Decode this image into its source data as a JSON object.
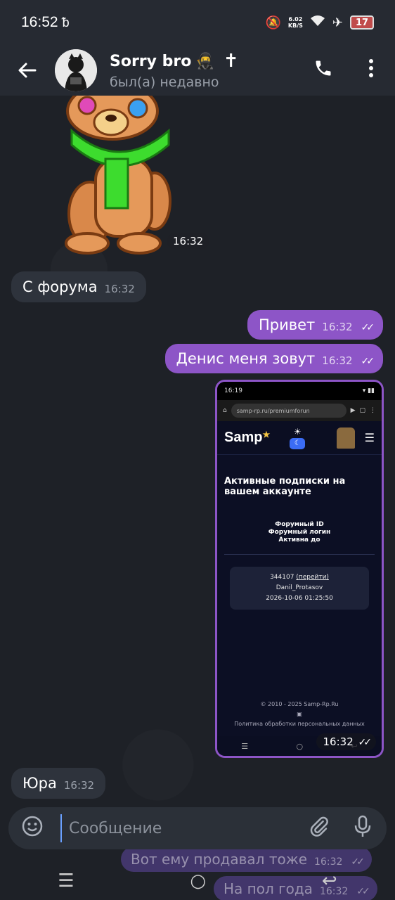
{
  "status": {
    "time": "16:52",
    "net_speed_top": "6.02",
    "net_speed_bottom": "KB/S",
    "battery": "17"
  },
  "header": {
    "title": "Sorry bro",
    "subtitle": "был(а) недавно"
  },
  "messages": [
    {
      "type": "sticker",
      "time": "16:32"
    },
    {
      "type": "in",
      "text": "С форума",
      "time": "16:32"
    },
    {
      "type": "out",
      "text": "Привет",
      "time": "16:32"
    },
    {
      "type": "out",
      "text": "Денис меня зовут",
      "time": "16:32"
    },
    {
      "type": "out-image",
      "time": "16:32"
    },
    {
      "type": "in",
      "text": "Юра",
      "time": "16:32"
    },
    {
      "type": "out",
      "text": "Вот ему продавал тоже",
      "time": "16:32"
    },
    {
      "type": "out",
      "text": "На пол года",
      "time": "16:32"
    }
  ],
  "screenshot": {
    "status_time": "16:19",
    "url": "samp-rp.ru/premiumforun",
    "logo": "Samp",
    "heading": "Активные подписки на вашем аккаунте",
    "field_1": "Форумный ID",
    "field_2": "Форумный логин",
    "field_3": "Активна до",
    "id_value": "344107",
    "id_link": "(перейти)",
    "login_value": "Danil_Protasov",
    "active_until": "2026-10-06 01:25:50",
    "footer_1": "© 2010 - 2025 Samp-Rp.Ru",
    "footer_2": "Политика обработки персональных данных"
  },
  "composer": {
    "placeholder": "Сообщение"
  },
  "colors": {
    "outgoing": "#8d55c7",
    "incoming": "#2e333c",
    "header": "#262a32"
  }
}
